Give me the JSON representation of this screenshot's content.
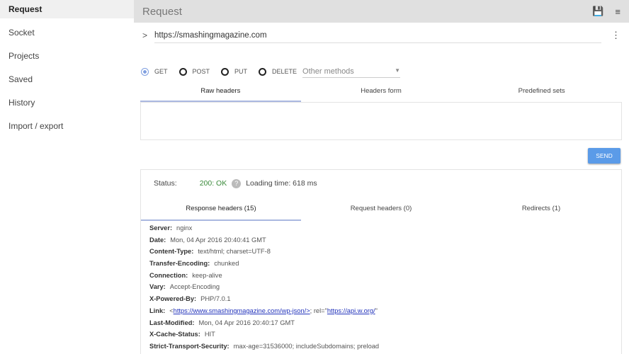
{
  "sidebar": {
    "items": [
      {
        "label": "Request"
      },
      {
        "label": "Socket"
      },
      {
        "label": "Projects"
      },
      {
        "label": "Saved"
      },
      {
        "label": "History"
      },
      {
        "label": "Import / export"
      }
    ]
  },
  "topbar": {
    "title": "Request"
  },
  "request": {
    "url": "https://smashingmagazine.com",
    "methods": [
      "GET",
      "POST",
      "PUT",
      "DELETE"
    ],
    "other_methods": "Other methods",
    "tabs": [
      "Raw headers",
      "Headers form",
      "Predefined sets"
    ],
    "send": "SEND"
  },
  "response": {
    "status_label": "Status:",
    "status": "200: OK",
    "loading": "Loading time: 618 ms",
    "tabs": [
      "Response headers (15)",
      "Request headers (0)",
      "Redirects (1)"
    ],
    "headers": [
      {
        "k": "Server:",
        "v": "nginx"
      },
      {
        "k": "Date:",
        "v": "Mon, 04 Apr 2016 20:40:41 GMT"
      },
      {
        "k": "Content-Type:",
        "v": "text/html; charset=UTF-8"
      },
      {
        "k": "Transfer-Encoding:",
        "v": "chunked"
      },
      {
        "k": "Connection:",
        "v": "keep-alive"
      },
      {
        "k": "Vary:",
        "v": "Accept-Encoding"
      },
      {
        "k": "X-Powered-By:",
        "v": "PHP/7.0.1"
      },
      {
        "k": "Link:",
        "pre": "<",
        "link1": "https://www.smashingmagazine.com/wp-json/>",
        "mid": "; rel=\"",
        "link2": "https://api.w.org/",
        "post": "\""
      },
      {
        "k": "Last-Modified:",
        "v": "Mon, 04 Apr 2016 20:40:17 GMT"
      },
      {
        "k": "X-Cache-Status:",
        "v": "HIT"
      },
      {
        "k": "Strict-Transport-Security:",
        "v": "max-age=31536000; includeSubdomains; preload"
      }
    ]
  }
}
